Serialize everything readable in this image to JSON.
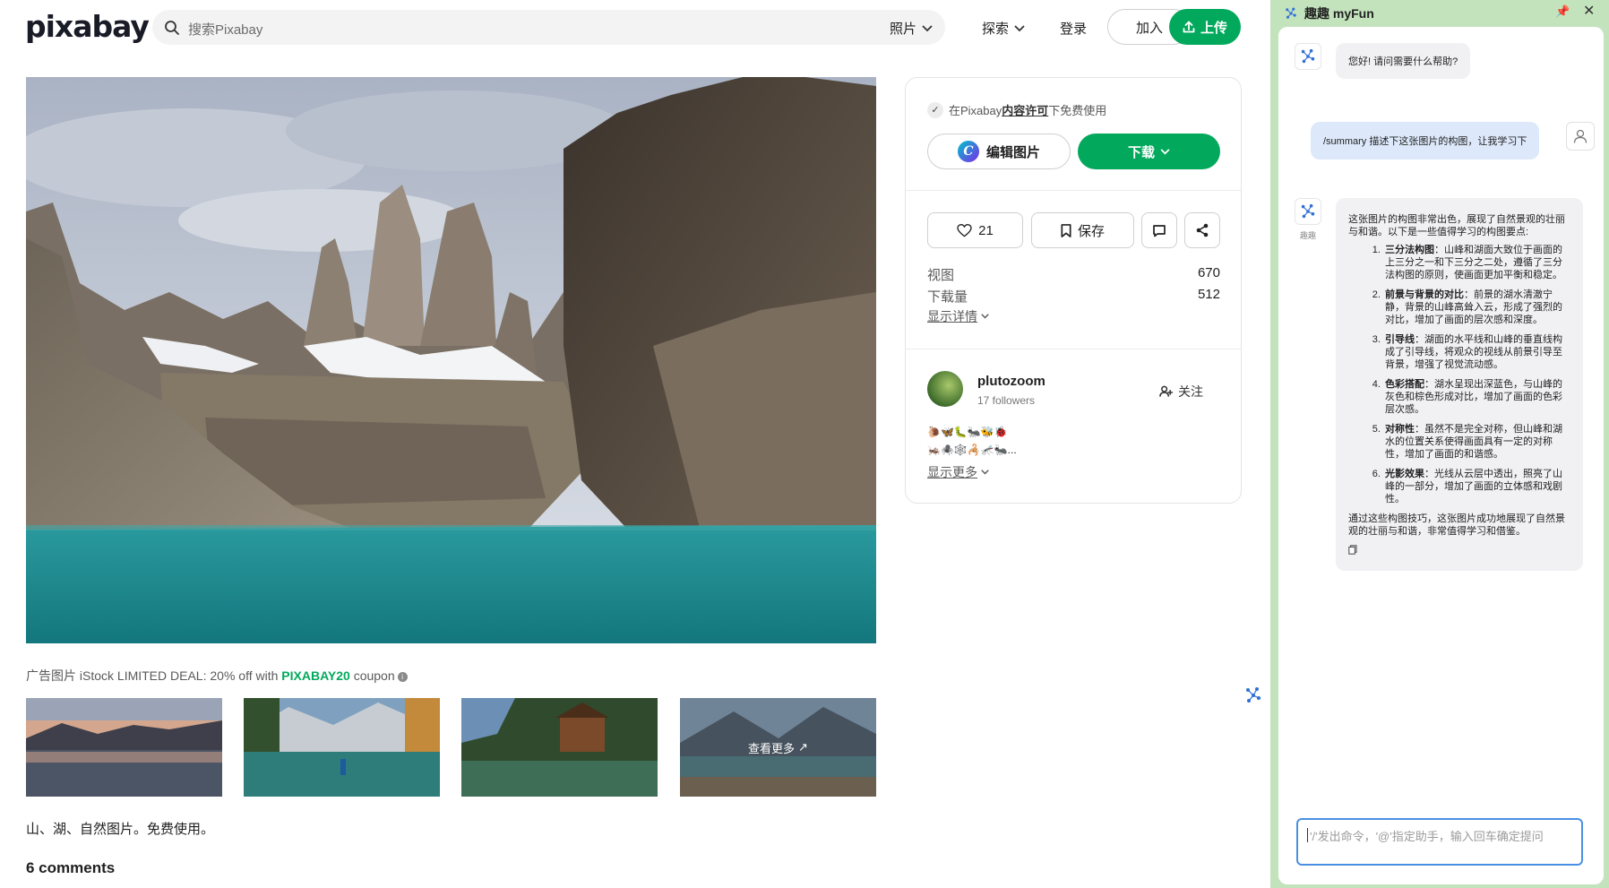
{
  "header": {
    "logo": "pixabay",
    "search_placeholder": "搜索Pixabay",
    "search_type": "照片",
    "explore": "探索",
    "login": "登录",
    "join": "加入",
    "upload": "上传"
  },
  "image": {
    "ad_prefix": "广告图片 iStock LIMITED DEAL: 20% off with ",
    "ad_coupon": "PIXABAY20",
    "ad_suffix": " coupon",
    "see_more": "查看更多",
    "tags": "山、湖、自然图片。免费使用。",
    "comments": "6 comments"
  },
  "card": {
    "license_prefix": "在Pixabay",
    "license_link": "内容许可",
    "license_suffix": "下免费使用",
    "edit": "编辑图片",
    "download": "下载",
    "likes": "21",
    "save": "保存",
    "views_label": "视图",
    "views_value": "670",
    "downloads_label": "下载量",
    "downloads_value": "512",
    "show_details": "显示详情",
    "author": "plutozoom",
    "followers": "17 followers",
    "follow": "关注",
    "bio_line1": "🐌🦋🐛🐜🐝🐞",
    "bio_line2": "🦗🕷️🕸️🦂🦟🐜...",
    "show_more": "显示更多"
  },
  "panel": {
    "title": "趣趣 myFun",
    "pin": "📌",
    "close": "✕",
    "bot_caption": "趣趣",
    "greeting": "您好! 请问需要什么帮助?",
    "user_message": "/summary 描述下这张图片的构图，让我学习下",
    "answer_intro": "这张图片的构图非常出色，展现了自然景观的壮丽与和谐。以下是一些值得学习的构图要点:",
    "points": [
      {
        "title": "三分法构图",
        "text": "：山峰和湖面大致位于画面的上三分之一和下三分之二处，遵循了三分法构图的原则，使画面更加平衡和稳定。"
      },
      {
        "title": "前景与背景的对比",
        "text": "：前景的湖水清澈宁静，背景的山峰高耸入云，形成了强烈的对比，增加了画面的层次感和深度。"
      },
      {
        "title": "引导线",
        "text": "：湖面的水平线和山峰的垂直线构成了引导线，将观众的视线从前景引导至背景，增强了视觉流动感。"
      },
      {
        "title": "色彩搭配",
        "text": "：湖水呈现出深蓝色，与山峰的灰色和棕色形成对比，增加了画面的色彩层次感。"
      },
      {
        "title": "对称性",
        "text": "：虽然不是完全对称，但山峰和湖水的位置关系使得画面具有一定的对称性，增加了画面的和谐感。"
      },
      {
        "title": "光影效果",
        "text": "：光线从云层中透出，照亮了山峰的一部分，增加了画面的立体感和戏剧性。"
      }
    ],
    "answer_outro": "通过这些构图技巧，这张图片成功地展现了自然景观的壮丽与和谐，非常值得学习和借鉴。",
    "input_placeholder": "'/'发出命令，'@'指定助手，输入回车确定提问"
  },
  "colors": {
    "brand_green": "#02a95c",
    "panel_bg": "#c3e3bd",
    "input_border": "#4a90e2"
  }
}
